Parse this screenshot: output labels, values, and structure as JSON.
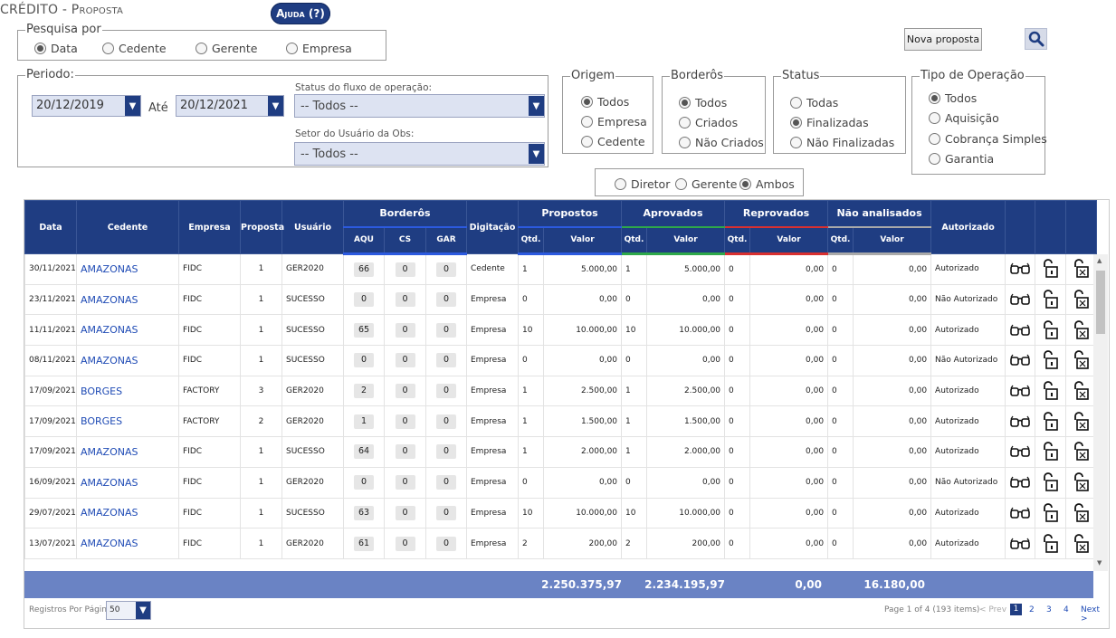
{
  "title": {
    "main": "CRÉDITO",
    "sep": " - ",
    "sub": "Proposta"
  },
  "help_label": "Ajuda (?)",
  "pesquisa": {
    "legend": "Pesquisa por",
    "options": [
      "Data",
      "Cedente",
      "Gerente",
      "Empresa"
    ],
    "selected": "Data"
  },
  "periodo": {
    "legend": "Periodo:",
    "from": "20/12/2019",
    "ate_label": "Até",
    "to": "20/12/2021",
    "status_label": "Status do fluxo de operação:",
    "status_value": "-- Todos --",
    "setor_label": "Setor do Usuário da Obs:",
    "setor_value": "-- Todos --"
  },
  "origem": {
    "legend": "Origem",
    "options": [
      "Todos",
      "Empresa",
      "Cedente"
    ],
    "selected": "Todos"
  },
  "borderos": {
    "legend": "Borderôs",
    "options": [
      "Todos",
      "Criados",
      "Não Criados"
    ],
    "selected": "Todos"
  },
  "status": {
    "legend": "Status",
    "options": [
      "Todas",
      "Finalizadas",
      "Não Finalizadas"
    ],
    "selected": "Finalizadas"
  },
  "tipo": {
    "legend": "Tipo de Operação",
    "options": [
      "Todos",
      "Aquisição",
      "Cobrança Simples",
      "Garantia"
    ],
    "selected": "Todos"
  },
  "aprov": {
    "options": [
      "Diretor",
      "Gerente",
      "Ambos"
    ],
    "selected": "Ambos"
  },
  "nova_proposta": "Nova proposta",
  "colors": {
    "primary": "#1f3d82",
    "footer": "#6a83c4",
    "blue": "#1b1bd1",
    "green": "#1e8a1e",
    "red": "#d41010"
  },
  "headers": {
    "data": "Data",
    "cedente": "Cedente",
    "empresa": "Empresa",
    "proposta": "Proposta",
    "usuario": "Usuário",
    "borderos": "Borderôs",
    "aqu": "AQU",
    "cs": "CS",
    "gar": "GAR",
    "digitacao": "Digitação",
    "propostos": "Propostos",
    "aprovados": "Aprovados",
    "reprovados": "Reprovados",
    "nao_analisados": "Não analisados",
    "qtd": "Qtd.",
    "valor": "Valor",
    "autorizado": "Autorizado"
  },
  "rows": [
    {
      "data": "30/11/2021",
      "cedente": "AMAZONAS",
      "empresa": "FIDC",
      "proposta": "1",
      "usuario": "GER2020",
      "aqu": "66",
      "cs": "0",
      "gar": "0",
      "digitacao": "Cedente",
      "p_qtd": "1",
      "p_val": "5.000,00",
      "a_qtd": "1",
      "a_val": "5.000,00",
      "r_qtd": "0",
      "r_val": "0,00",
      "n_qtd": "0",
      "n_val": "0,00",
      "autorizado": "Autorizado"
    },
    {
      "data": "23/11/2021",
      "cedente": "AMAZONAS",
      "empresa": "FIDC",
      "proposta": "1",
      "usuario": "SUCESSO",
      "aqu": "0",
      "cs": "0",
      "gar": "0",
      "digitacao": "Empresa",
      "p_qtd": "0",
      "p_val": "0,00",
      "a_qtd": "0",
      "a_val": "0,00",
      "r_qtd": "0",
      "r_val": "0,00",
      "n_qtd": "0",
      "n_val": "0,00",
      "autorizado": "Não Autorizado"
    },
    {
      "data": "11/11/2021",
      "cedente": "AMAZONAS",
      "empresa": "FIDC",
      "proposta": "1",
      "usuario": "SUCESSO",
      "aqu": "65",
      "cs": "0",
      "gar": "0",
      "digitacao": "Empresa",
      "p_qtd": "10",
      "p_val": "10.000,00",
      "a_qtd": "10",
      "a_val": "10.000,00",
      "r_qtd": "0",
      "r_val": "0,00",
      "n_qtd": "0",
      "n_val": "0,00",
      "autorizado": "Autorizado"
    },
    {
      "data": "08/11/2021",
      "cedente": "AMAZONAS",
      "empresa": "FIDC",
      "proposta": "1",
      "usuario": "SUCESSO",
      "aqu": "0",
      "cs": "0",
      "gar": "0",
      "digitacao": "Empresa",
      "p_qtd": "0",
      "p_val": "0,00",
      "a_qtd": "0",
      "a_val": "0,00",
      "r_qtd": "0",
      "r_val": "0,00",
      "n_qtd": "0",
      "n_val": "0,00",
      "autorizado": "Não Autorizado"
    },
    {
      "data": "17/09/2021",
      "cedente": "BORGES",
      "empresa": "FACTORY",
      "proposta": "3",
      "usuario": "GER2020",
      "aqu": "2",
      "cs": "0",
      "gar": "0",
      "digitacao": "Empresa",
      "p_qtd": "1",
      "p_val": "2.500,00",
      "a_qtd": "1",
      "a_val": "2.500,00",
      "r_qtd": "0",
      "r_val": "0,00",
      "n_qtd": "0",
      "n_val": "0,00",
      "autorizado": "Autorizado"
    },
    {
      "data": "17/09/2021",
      "cedente": "BORGES",
      "empresa": "FACTORY",
      "proposta": "2",
      "usuario": "GER2020",
      "aqu": "1",
      "cs": "0",
      "gar": "0",
      "digitacao": "Empresa",
      "p_qtd": "1",
      "p_val": "1.500,00",
      "a_qtd": "1",
      "a_val": "1.500,00",
      "r_qtd": "0",
      "r_val": "0,00",
      "n_qtd": "0",
      "n_val": "0,00",
      "autorizado": "Autorizado"
    },
    {
      "data": "17/09/2021",
      "cedente": "AMAZONAS",
      "empresa": "FIDC",
      "proposta": "1",
      "usuario": "SUCESSO",
      "aqu": "64",
      "cs": "0",
      "gar": "0",
      "digitacao": "Empresa",
      "p_qtd": "1",
      "p_val": "2.000,00",
      "a_qtd": "1",
      "a_val": "2.000,00",
      "r_qtd": "0",
      "r_val": "0,00",
      "n_qtd": "0",
      "n_val": "0,00",
      "autorizado": "Autorizado"
    },
    {
      "data": "16/09/2021",
      "cedente": "AMAZONAS",
      "empresa": "FIDC",
      "proposta": "1",
      "usuario": "GER2020",
      "aqu": "0",
      "cs": "0",
      "gar": "0",
      "digitacao": "Empresa",
      "p_qtd": "0",
      "p_val": "0,00",
      "a_qtd": "0",
      "a_val": "0,00",
      "r_qtd": "0",
      "r_val": "0,00",
      "n_qtd": "0",
      "n_val": "0,00",
      "autorizado": "Não Autorizado"
    },
    {
      "data": "29/07/2021",
      "cedente": "AMAZONAS",
      "empresa": "FIDC",
      "proposta": "1",
      "usuario": "SUCESSO",
      "aqu": "63",
      "cs": "0",
      "gar": "0",
      "digitacao": "Empresa",
      "p_qtd": "10",
      "p_val": "10.000,00",
      "a_qtd": "10",
      "a_val": "10.000,00",
      "r_qtd": "0",
      "r_val": "0,00",
      "n_qtd": "0",
      "n_val": "0,00",
      "autorizado": "Autorizado"
    },
    {
      "data": "13/07/2021",
      "cedente": "AMAZONAS",
      "empresa": "FIDC",
      "proposta": "1",
      "usuario": "GER2020",
      "aqu": "61",
      "cs": "0",
      "gar": "0",
      "digitacao": "Empresa",
      "p_qtd": "2",
      "p_val": "200,00",
      "a_qtd": "2",
      "a_val": "200,00",
      "r_qtd": "0",
      "r_val": "0,00",
      "n_qtd": "0",
      "n_val": "0,00",
      "autorizado": "Autorizado"
    }
  ],
  "totals": {
    "propostos": "2.250.375,97",
    "aprovados": "2.234.195,97",
    "reprovados": "0,00",
    "nao_analisados": "16.180,00"
  },
  "pager": {
    "per_page_label": "Registros Por Página",
    "per_page_value": "50",
    "info": "Page 1 of 4 (193 items)",
    "prev": "< Prev",
    "pages": [
      "1",
      "2",
      "3",
      "4"
    ],
    "next": "Next >"
  }
}
